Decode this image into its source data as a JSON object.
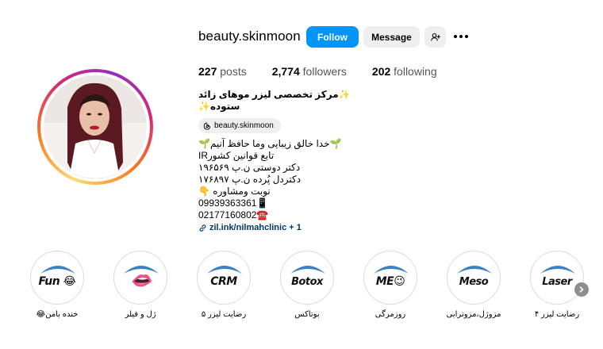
{
  "profile": {
    "username": "beauty.skinmoon",
    "follow_label": "Follow",
    "message_label": "Message",
    "stats": {
      "posts_count": "227",
      "posts_label": "posts",
      "followers_count": "2,774",
      "followers_label": "followers",
      "following_count": "202",
      "following_label": "following"
    },
    "bio": {
      "title": "✨مرکز تخصصی لیزر موهای زائد ستوده✨",
      "threads_handle": "beauty.skinmoon",
      "lines": [
        "🌱خدا خالق زیبایی وما حافظ آنیم🌱",
        "تابع قوانین کشورIR",
        "دکتر دوستی ن.پ ۱۹۶۵۶۹",
        "دکتردل پُرده ن.پ ۱۷۶۸۹۷",
        "نوبت ومشاوره 👇",
        "09939363361📱",
        "02177160802☎️"
      ],
      "link": "zil.ink/nilmahclinic + 1"
    }
  },
  "highlights": [
    {
      "word": "Fun 😂",
      "label": "خنده بامن😂"
    },
    {
      "word": "👄",
      "label": "ژل و فیلر"
    },
    {
      "word": "CRM",
      "label": "رضایت لیزر ۵"
    },
    {
      "word": "Botox",
      "label": "بوتاکس"
    },
    {
      "word": "ME😉",
      "label": "روزمرگی"
    },
    {
      "word": "Meso",
      "label": "مزوژل،مزوترابی"
    },
    {
      "word": "Laser",
      "label": "رضایت لیزر ۴"
    }
  ],
  "colors": {
    "follow_bg": "#0095f6",
    "link": "#00376b",
    "secondary_btn_bg": "#efefef",
    "highlight_arc": "#3b82c4"
  },
  "icons": {
    "add_user": "person-add-icon",
    "more": "more-horizontal-icon",
    "threads": "threads-icon",
    "link": "link-icon",
    "next": "chevron-right-icon"
  }
}
